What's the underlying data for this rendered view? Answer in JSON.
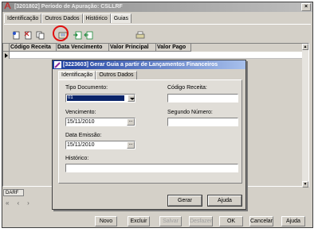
{
  "window": {
    "title": "[3201802] Período de Apuração: CSLLRF",
    "close_glyph": "×"
  },
  "tabs": [
    {
      "label": "Identificação"
    },
    {
      "label": "Outros Dados"
    },
    {
      "label": "Histórico"
    },
    {
      "label": "Guias",
      "active": true
    }
  ],
  "toolbar": {
    "icons": [
      "new-document-icon",
      "delete-document-icon",
      "copy-document-icon",
      "generate-guide-icon",
      "export-icon",
      "import-icon",
      "print-icon"
    ]
  },
  "grid": {
    "columns": [
      "Código Receita",
      "Data Vencimento",
      "Valor Principal",
      "Valor Pago"
    ],
    "scroll_up": "▲",
    "scroll_down": "▼"
  },
  "darf_tab": "DARF",
  "nav": {
    "first": "«",
    "prev": "‹",
    "next": "›"
  },
  "bottom_buttons": {
    "novo": "Novo",
    "excluir": "Excluir",
    "salvar": "Salvar",
    "desfazer": "Desfazer",
    "ok": "OK",
    "cancelar": "Cancelar",
    "ajuda": "Ajuda"
  },
  "dialog": {
    "title": "[3223603] Gerar Guia a partir de Lançamentos Financeiros",
    "tabs": [
      {
        "label": "Identificação",
        "active": true
      },
      {
        "label": "Outros Dados"
      }
    ],
    "fields": {
      "tipo_documento_label": "Tipo Documento:",
      "tipo_documento_value": "01",
      "codigo_receita_label": "Código Receita:",
      "codigo_receita_value": "",
      "vencimento_label": "Vencimento:",
      "vencimento_value": "15/11/2010",
      "segundo_numero_label": "Segundo Número:",
      "segundo_numero_value": "",
      "data_emissao_label": "Data Emissão:",
      "data_emissao_value": "15/11/2010",
      "historico_label": "Histórico:",
      "historico_value": "",
      "ellipsis": "..."
    },
    "buttons": {
      "gerar": "Gerar",
      "ajuda": "Ajuda"
    }
  },
  "colors": {
    "dialog_title_start": "#1a3c9e",
    "highlight": "#e01010",
    "selection": "#0a246a"
  }
}
